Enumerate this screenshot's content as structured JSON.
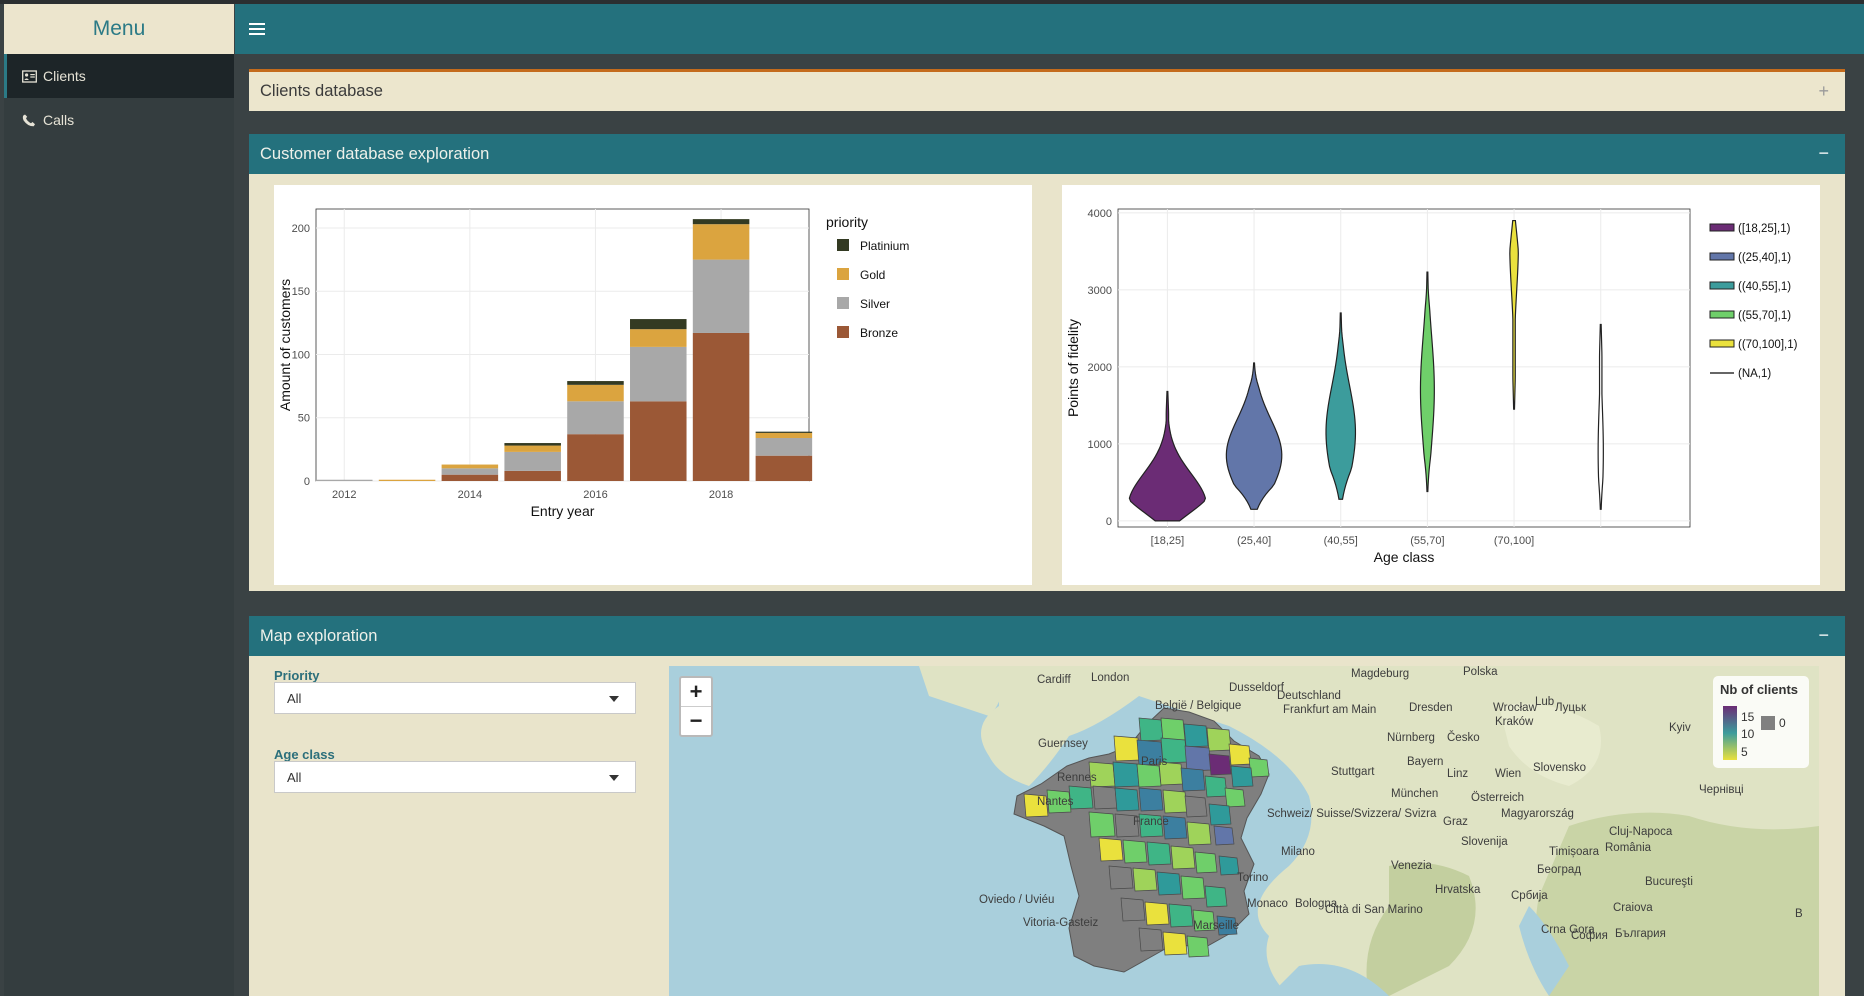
{
  "sidebar": {
    "title": "Menu",
    "items": [
      {
        "label": "Clients",
        "icon": "address-card-icon",
        "active": true
      },
      {
        "label": "Calls",
        "icon": "phone-icon",
        "active": false
      }
    ]
  },
  "boxes": {
    "clients_db": {
      "title": "Clients database",
      "tool": "+"
    },
    "exploration": {
      "title": "Customer database exploration",
      "tool": "−"
    },
    "map": {
      "title": "Map exploration",
      "tool": "−"
    }
  },
  "filters": {
    "priority_label": "Priority",
    "priority_value": "All",
    "age_label": "Age class",
    "age_value": "All"
  },
  "colors": {
    "teal": "#24717d",
    "cream": "#e9e4cb",
    "platinium": "#333a22",
    "gold": "#dba43f",
    "silver": "#a8a8a8",
    "bronze": "#9b5836"
  },
  "chart_data": [
    {
      "type": "bar",
      "stacked": true,
      "xlabel": "Entry year",
      "ylabel": "Amount of customers",
      "ylim": [
        0,
        215
      ],
      "yticks": [
        0,
        50,
        100,
        150,
        200
      ],
      "xticks": [
        "2012",
        "2014",
        "2016",
        "2018"
      ],
      "legend_title": "priority",
      "legend_position": "right",
      "grid": true,
      "categories": [
        2012,
        2013,
        2014,
        2015,
        2016,
        2017,
        2018,
        2019
      ],
      "series": [
        {
          "name": "Bronze",
          "values": [
            0,
            0,
            5,
            8,
            37,
            63,
            117,
            20
          ]
        },
        {
          "name": "Silver",
          "values": [
            1,
            0,
            5,
            15,
            26,
            43,
            58,
            14
          ]
        },
        {
          "name": "Gold",
          "values": [
            0,
            1,
            3,
            5,
            13,
            14,
            28,
            4
          ]
        },
        {
          "name": "Platinium",
          "values": [
            0,
            0,
            0,
            2,
            3,
            8,
            4,
            1
          ]
        }
      ]
    },
    {
      "type": "violin",
      "xlabel": "Age class",
      "ylabel": "Points of fidelity",
      "ylim": [
        -80,
        4050
      ],
      "yticks": [
        0,
        1000,
        2000,
        3000,
        4000
      ],
      "categories": [
        "[18,25]",
        "(25,40]",
        "(40,55]",
        "(55,70]",
        "(70,100]",
        ""
      ],
      "legend_position": "right",
      "grid": true,
      "series": [
        {
          "name": "([18,25],1)",
          "color": "#6b2c75",
          "min": 0,
          "max": 1680,
          "max_width": 0.45,
          "peak": 200
        },
        {
          "name": "((25,40],1)",
          "color": "#6276a9",
          "min": 150,
          "max": 2050,
          "max_width": 0.32,
          "peak": 850
        },
        {
          "name": "((40,55],1)",
          "color": "#3c9c9c",
          "min": 280,
          "max": 2700,
          "max_width": 0.17,
          "peak": 1150
        },
        {
          "name": "((55,70],1)",
          "color": "#6fcf6a",
          "min": 380,
          "max": 3230,
          "max_width": 0.08,
          "peak": 1700
        },
        {
          "name": "((70,100],1)",
          "color": "#eae13d",
          "min": 1450,
          "max": 3900,
          "max_width": 0.05,
          "peak": 3600
        },
        {
          "name": "(NA,1)",
          "color": "#555555",
          "min": 150,
          "max": 2550,
          "max_width": 0.03,
          "peak": 900
        }
      ]
    }
  ],
  "map": {
    "zoom_in": "+",
    "zoom_out": "−",
    "legend_title": "Nb of clients",
    "legend_ticks": [
      "15",
      "10",
      "5"
    ],
    "legend_na": "0",
    "places": [
      {
        "name": "Cardiff"
      },
      {
        "name": "London"
      },
      {
        "name": "Dusseldorf"
      },
      {
        "name": "Deutschland"
      },
      {
        "name": "Magdeburg"
      },
      {
        "name": "Polska"
      },
      {
        "name": "Dresden"
      },
      {
        "name": "Wrocław"
      },
      {
        "name": "Frankfurt am Main"
      },
      {
        "name": "België / Belgique"
      },
      {
        "name": "Česko"
      },
      {
        "name": "Kraków"
      },
      {
        "name": "Nürnberg"
      },
      {
        "name": "Bayern"
      },
      {
        "name": "Stuttgart"
      },
      {
        "name": "Linz"
      },
      {
        "name": "Wien"
      },
      {
        "name": "Slovensko"
      },
      {
        "name": "München"
      },
      {
        "name": "Österreich"
      },
      {
        "name": "Schweiz/ Suisse/Svizzera/ Svizra"
      },
      {
        "name": "Magyarország"
      },
      {
        "name": "Graz"
      },
      {
        "name": "Milano"
      },
      {
        "name": "Slovenija"
      },
      {
        "name": "Timișoara"
      },
      {
        "name": "Cluj-Napoca"
      },
      {
        "name": "România"
      },
      {
        "name": "Torino"
      },
      {
        "name": "Venezia"
      },
      {
        "name": "Hrvatska"
      },
      {
        "name": "Београд"
      },
      {
        "name": "Bucureşti"
      },
      {
        "name": "Oviedo / Uviéu"
      },
      {
        "name": "Vitoria-Gasteiz"
      },
      {
        "name": "Marseille"
      },
      {
        "name": "Bologna"
      },
      {
        "name": "Città di San Marino"
      },
      {
        "name": "Србија"
      },
      {
        "name": "Craiova"
      },
      {
        "name": "Crna Gora"
      },
      {
        "name": "София"
      },
      {
        "name": "България"
      },
      {
        "name": "Guernsey"
      },
      {
        "name": "Rennes"
      },
      {
        "name": "Nantes"
      },
      {
        "name": "Paris"
      },
      {
        "name": "France"
      },
      {
        "name": "Monaco"
      },
      {
        "name": "Lub"
      },
      {
        "name": "Луцьк"
      },
      {
        "name": "Kyiv"
      },
      {
        "name": "Чернівці"
      },
      {
        "name": "В"
      }
    ]
  }
}
